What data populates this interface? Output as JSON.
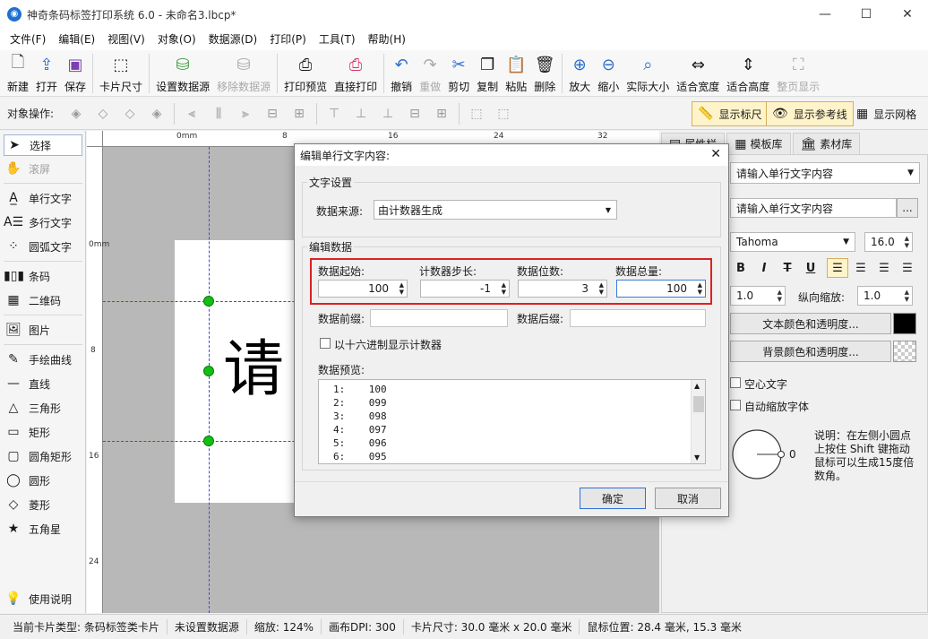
{
  "window": {
    "title": "神奇条码标签打印系统 6.0 - 未命名3.lbcp*",
    "minimize": "—",
    "maximize": "☐",
    "close": "✕"
  },
  "menu": [
    "文件(F)",
    "编辑(E)",
    "视图(V)",
    "对象(O)",
    "数据源(D)",
    "打印(P)",
    "工具(T)",
    "帮助(H)"
  ],
  "toolbar": {
    "new": "新建",
    "open": "打开",
    "save": "保存",
    "card_size": "卡片尺寸",
    "set_datasource": "设置数据源",
    "remove_datasource": "移除数据源",
    "print_preview": "打印预览",
    "print_direct": "直接打印",
    "undo": "撤销",
    "redo": "重做",
    "cut": "剪切",
    "copy": "复制",
    "paste": "粘贴",
    "delete": "删除",
    "zoom_in": "放大",
    "zoom_out": "缩小",
    "actual_size": "实际大小",
    "fit_width": "适合宽度",
    "fit_height": "适合高度",
    "full_page": "整页显示"
  },
  "ops": {
    "label": "对象操作:",
    "show_ruler": "显示标尺",
    "show_guides": "显示参考线",
    "show_grid": "显示网格"
  },
  "tools": {
    "select": "选择",
    "scroll": "滚屏",
    "single_text": "单行文字",
    "multi_text": "多行文字",
    "arc_text": "圆弧文字",
    "barcode": "条码",
    "qrcode": "二维码",
    "image": "图片",
    "freehand": "手绘曲线",
    "line": "直线",
    "triangle": "三角形",
    "rect": "矩形",
    "round_rect": "圆角矩形",
    "ellipse": "圆形",
    "diamond": "菱形",
    "star": "五角星",
    "help": "使用说明"
  },
  "ruler": {
    "h_unit": "0mm",
    "h8": "8",
    "h16": "16",
    "h24": "24",
    "h32": "32",
    "v_unit": "0mm",
    "v8": "8",
    "v16": "16",
    "v24": "24"
  },
  "canvas": {
    "text": "请"
  },
  "right": {
    "tab_props": "属性栏",
    "tab_templates": "模板库",
    "tab_assets": "素材库",
    "content_select": "请输入单行文字内容",
    "content_field": "请输入单行文字内容",
    "ellipsis": "...",
    "font": "Tahoma",
    "font_size": "16.0",
    "bold": "B",
    "italic": "I",
    "strike": "T",
    "underline": "U",
    "h_scale": "1.0",
    "v_scale_label": "纵向缩放:",
    "v_scale": "1.0",
    "text_color": "文本颜色和透明度...",
    "bg_color": "背景颜色和透明度...",
    "hollow": "空心文字",
    "auto_shrink": "自动缩放字体",
    "angle": "0",
    "note": "说明：在左侧小圆点上按住 Shift 键拖动鼠标可以生成15度倍数角。"
  },
  "status": {
    "card_type": "当前卡片类型:  条码标签类卡片",
    "datasource": "未设置数据源",
    "zoom": "缩放: 124%",
    "dpi": "画布DPI:  300",
    "card_size": "卡片尺寸:  30.0 毫米 x 20.0 毫米",
    "mouse": "鼠标位置:  28.4 毫米, 15.3 毫米"
  },
  "dialog": {
    "title": "编辑单行文字内容:",
    "group_text": "文字设置",
    "source_label": "数据来源:",
    "source_value": "由计数器生成",
    "group_data": "编辑数据",
    "start_label": "数据起始:",
    "start_value": "100",
    "step_label": "计数器步长:",
    "step_value": "-1",
    "digits_label": "数据位数:",
    "digits_value": "3",
    "total_label": "数据总量:",
    "total_value": "100",
    "prefix_label": "数据前缀:",
    "suffix_label": "数据后缀:",
    "hex_label": "以十六进制显示计数器",
    "preview_label": "数据预览:",
    "preview_rows": [
      {
        "n": "1:",
        "v": "100"
      },
      {
        "n": "2:",
        "v": "099"
      },
      {
        "n": "3:",
        "v": "098"
      },
      {
        "n": "4:",
        "v": "097"
      },
      {
        "n": "5:",
        "v": "096"
      },
      {
        "n": "6:",
        "v": "095"
      }
    ],
    "ok": "确定",
    "cancel": "取消"
  }
}
